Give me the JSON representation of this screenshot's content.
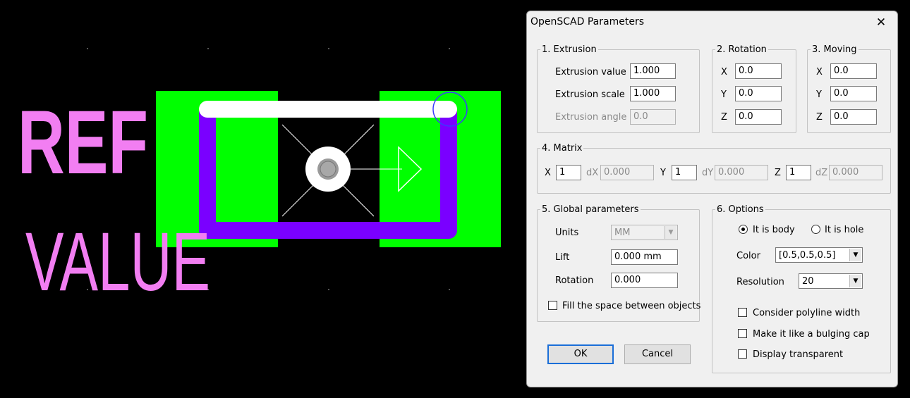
{
  "pcb": {
    "ref_text": "REF",
    "value_text": "VALUE",
    "colors": {
      "background": "#000000",
      "silkscreen_text": "#f27ef2",
      "pad": "#00ff00",
      "outline_top": "#ffffff",
      "outline_body": "#7a00ff",
      "marker": "#ffffff",
      "origin_inner": "#9a9a9a",
      "pin1_circle": "#3a3aff"
    }
  },
  "dialog": {
    "title": "OpenSCAD Parameters",
    "close_glyph": "✕",
    "extrusion": {
      "legend": "1. Extrusion",
      "value_label": "Extrusion value",
      "value": "1.000",
      "scale_label": "Extrusion scale",
      "scale": "1.000",
      "angle_label": "Extrusion angle",
      "angle": "0.0"
    },
    "rotation": {
      "legend": "2. Rotation",
      "x_label": "X",
      "x": "0.0",
      "y_label": "Y",
      "y": "0.0",
      "z_label": "Z",
      "z": "0.0"
    },
    "moving": {
      "legend": "3. Moving",
      "x_label": "X",
      "x": "0.0",
      "y_label": "Y",
      "y": "0.0",
      "z_label": "Z",
      "z": "0.0"
    },
    "matrix": {
      "legend": "4. Matrix",
      "x_label": "X",
      "x": "1",
      "dx_label": "dX",
      "dx": "0.000",
      "y_label": "Y",
      "y": "1",
      "dy_label": "dY",
      "dy": "0.000",
      "z_label": "Z",
      "z": "1",
      "dz_label": "dZ",
      "dz": "0.000"
    },
    "global": {
      "legend": "5. Global parameters",
      "units_label": "Units",
      "units": "MM",
      "lift_label": "Lift",
      "lift": "0.000 mm",
      "rotation_label": "Rotation",
      "rotation": "0.000",
      "fill_label": "Fill the space between objects",
      "fill_checked": false
    },
    "options": {
      "legend": "6. Options",
      "body_label": "It is body",
      "body_selected": true,
      "hole_label": "It is hole",
      "hole_selected": false,
      "color_label": "Color",
      "color": "[0.5,0.5,0.5]",
      "resolution_label": "Resolution",
      "resolution": "20",
      "polyline_label": "Consider polyline width",
      "polyline_checked": false,
      "bulging_label": "Make it like a bulging cap",
      "bulging_checked": false,
      "transparent_label": "Display transparent",
      "transparent_checked": false
    },
    "ok_label": "OK",
    "cancel_label": "Cancel"
  }
}
